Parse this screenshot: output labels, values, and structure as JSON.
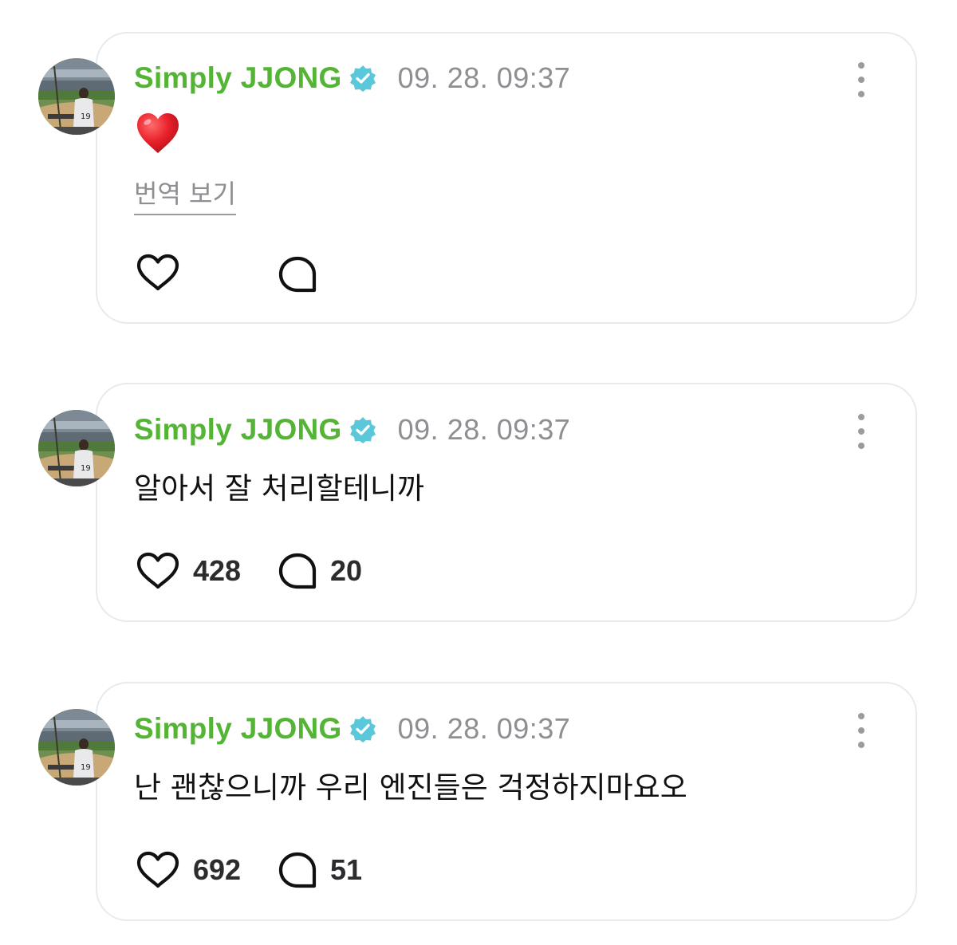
{
  "colors": {
    "author": "#54b435",
    "verified_badge": "#5ac8d8",
    "timestamp": "#8e8e93",
    "card_border": "#e9e9ee"
  },
  "posts": [
    {
      "author": "Simply JJONG",
      "verified": true,
      "timestamp": "09. 28. 09:37",
      "content_emoji": "red-heart",
      "translate_label": "번역 보기",
      "like_icon": "heart-outline-icon",
      "comment_icon": "speech-bubble-icon",
      "likes": "",
      "comments": ""
    },
    {
      "author": "Simply JJONG",
      "verified": true,
      "timestamp": "09. 28. 09:37",
      "text": "알아서 잘 처리할테니까",
      "like_icon": "heart-outline-icon",
      "comment_icon": "speech-bubble-icon",
      "likes": "428",
      "comments": "20"
    },
    {
      "author": "Simply JJONG",
      "verified": true,
      "timestamp": "09. 28. 09:37",
      "text": "난 괜찮으니까 우리 엔진들은 걱정하지마요오",
      "like_icon": "heart-outline-icon",
      "comment_icon": "speech-bubble-icon",
      "likes": "692",
      "comments": "51"
    }
  ]
}
